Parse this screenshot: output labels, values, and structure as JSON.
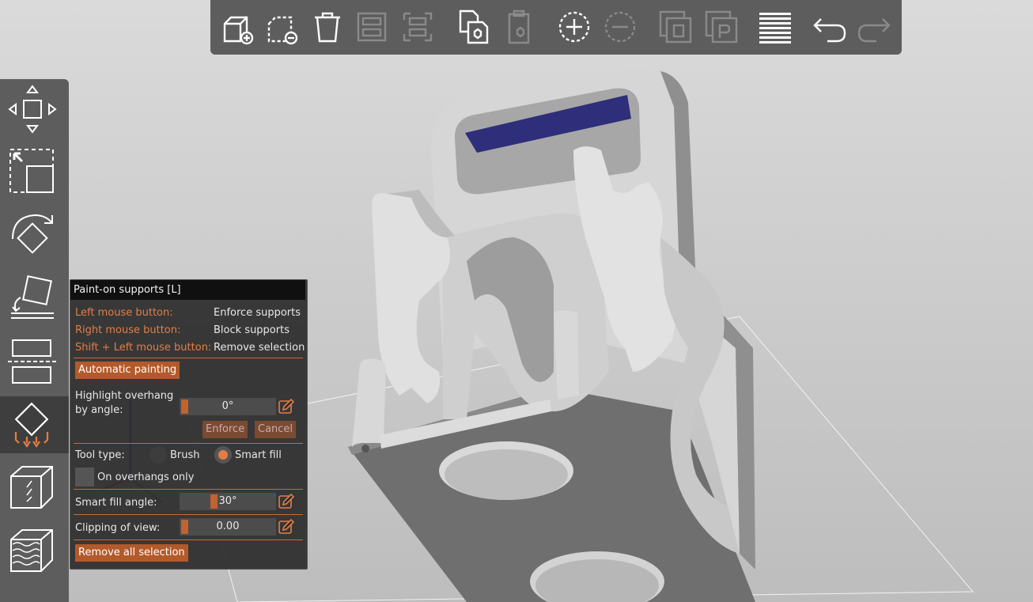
{
  "toolbar": {
    "buttons": [
      {
        "icon": "add-object-icon",
        "enabled": true
      },
      {
        "icon": "delete-object-icon",
        "enabled": true
      },
      {
        "icon": "delete-all-icon",
        "enabled": true
      },
      {
        "icon": "arrange-icon",
        "enabled": false
      },
      {
        "icon": "split-icon",
        "enabled": false
      },
      {
        "icon": "copy-icon",
        "enabled": true
      },
      {
        "icon": "paste-icon",
        "enabled": false
      },
      {
        "icon": "add-instance-icon",
        "enabled": true
      },
      {
        "icon": "remove-instance-icon",
        "enabled": false
      },
      {
        "icon": "split-to-objects-icon",
        "enabled": false
      },
      {
        "icon": "split-to-parts-icon",
        "enabled": false
      },
      {
        "icon": "layers-editing-icon",
        "enabled": true
      },
      {
        "icon": "undo-icon",
        "enabled": true
      },
      {
        "icon": "redo-icon",
        "enabled": false
      }
    ]
  },
  "sidebar": {
    "tools": [
      {
        "icon": "move-icon",
        "active": false
      },
      {
        "icon": "scale-icon",
        "active": false
      },
      {
        "icon": "rotate-icon",
        "active": false
      },
      {
        "icon": "place-on-face-icon",
        "active": false
      },
      {
        "icon": "cut-icon",
        "active": false
      },
      {
        "icon": "paint-supports-icon",
        "active": true
      },
      {
        "icon": "seam-painting-icon",
        "active": false
      },
      {
        "icon": "multimaterial-painting-icon",
        "active": false
      }
    ]
  },
  "panel": {
    "title": "Paint-on supports [L]",
    "left_mouse_label": "Left mouse button:",
    "left_mouse_value": "Enforce supports",
    "right_mouse_label": "Right mouse button:",
    "right_mouse_value": "Block supports",
    "shift_left_label": "Shift + Left mouse button:",
    "shift_left_value": "Remove selection",
    "auto_painting": "Automatic painting",
    "highlight_label_1": "Highlight overhang",
    "highlight_label_2": "by angle:",
    "highlight_value": "0°",
    "highlight_fraction": 0.0,
    "enforce": "Enforce",
    "cancel": "Cancel",
    "tool_type_label": "Tool type:",
    "brush": "Brush",
    "smart_fill": "Smart fill",
    "tool_type_selected": "Smart fill",
    "on_overhangs_only": "On overhangs only",
    "on_overhangs_checked": false,
    "smart_fill_angle_label": "Smart fill angle:",
    "smart_fill_angle_value": "30°",
    "smart_fill_fraction": 0.33,
    "clipping_label": "Clipping of view:",
    "clipping_value": "0.00",
    "clipping_fraction": 0.0,
    "remove_all": "Remove all selection"
  },
  "colors": {
    "accent": "#e37d45",
    "toolbar_bg": "#5d5d5d",
    "viewport_bg": "#c9c9c9",
    "model": "#d8d8d8",
    "model_shadow": "#a9a9a9",
    "plate": "#707070",
    "enforced_paint": "#2e2e7a"
  }
}
